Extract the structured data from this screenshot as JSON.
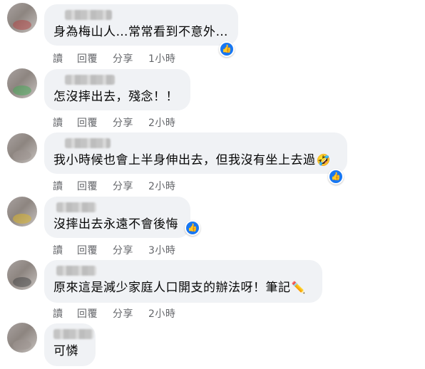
{
  "actions": {
    "read": "讀",
    "reply": "回覆",
    "share": "分享"
  },
  "colors": {
    "bubble": "#f0f2f5",
    "like": "#1877f2",
    "meta_text": "#65676b"
  },
  "comments": [
    {
      "text": "身為梅山人…常常看到不意外…",
      "time": "1小時",
      "liked": true,
      "emoji": ""
    },
    {
      "text": "怎沒摔出去，殘念！！",
      "time": "2小時",
      "liked": false,
      "emoji": ""
    },
    {
      "text": "我小時候也會上半身伸出去，但我沒有坐上去過",
      "time": "2小時",
      "liked": true,
      "emoji": "🤣"
    },
    {
      "text": "沒摔出去永遠不會後悔",
      "time": "3小時",
      "liked": true,
      "emoji": ""
    },
    {
      "text": "原來這是減少家庭人口開支的辦法呀！筆記",
      "time": "2小時",
      "liked": false,
      "emoji": "✏️"
    },
    {
      "text": "可憐",
      "time": "",
      "liked": false,
      "emoji": ""
    }
  ],
  "icons": {
    "like": "like-thumb-icon"
  }
}
